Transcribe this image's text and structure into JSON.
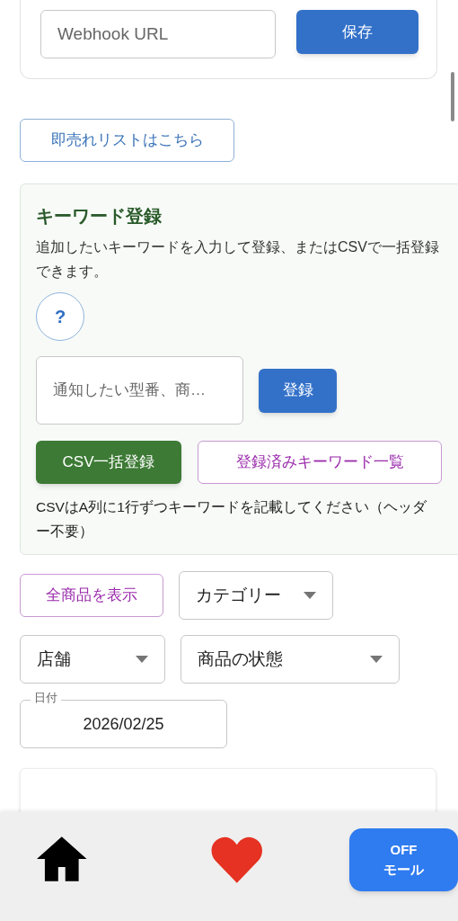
{
  "webhook": {
    "placeholder": "Webhook URL",
    "save_button": "保存"
  },
  "instant_sold_link": "即売れリストはこちら",
  "keyword_panel": {
    "title": "キーワード登録",
    "description": "追加したいキーワードを入力して登録、またはCSVで一括登録できます。",
    "help_button": "?",
    "keyword_field": {
      "placeholder": "通知したい型番、商…"
    },
    "register_button": "登録",
    "csv_button": "CSV一括登録",
    "list_button": "登録済みキーワード一覧",
    "note": "CSVはA列に1行ずつキーワードを記載してください（ヘッダー不要）"
  },
  "filters": {
    "show_all_button": "全商品を表示",
    "selects": [
      "カテゴリー",
      "店舗",
      "商品の状態"
    ],
    "date": {
      "label": "日付",
      "value": "2026/02/25"
    }
  },
  "bottom_nav": {
    "mall_button": [
      "OFF",
      "モール"
    ]
  }
}
